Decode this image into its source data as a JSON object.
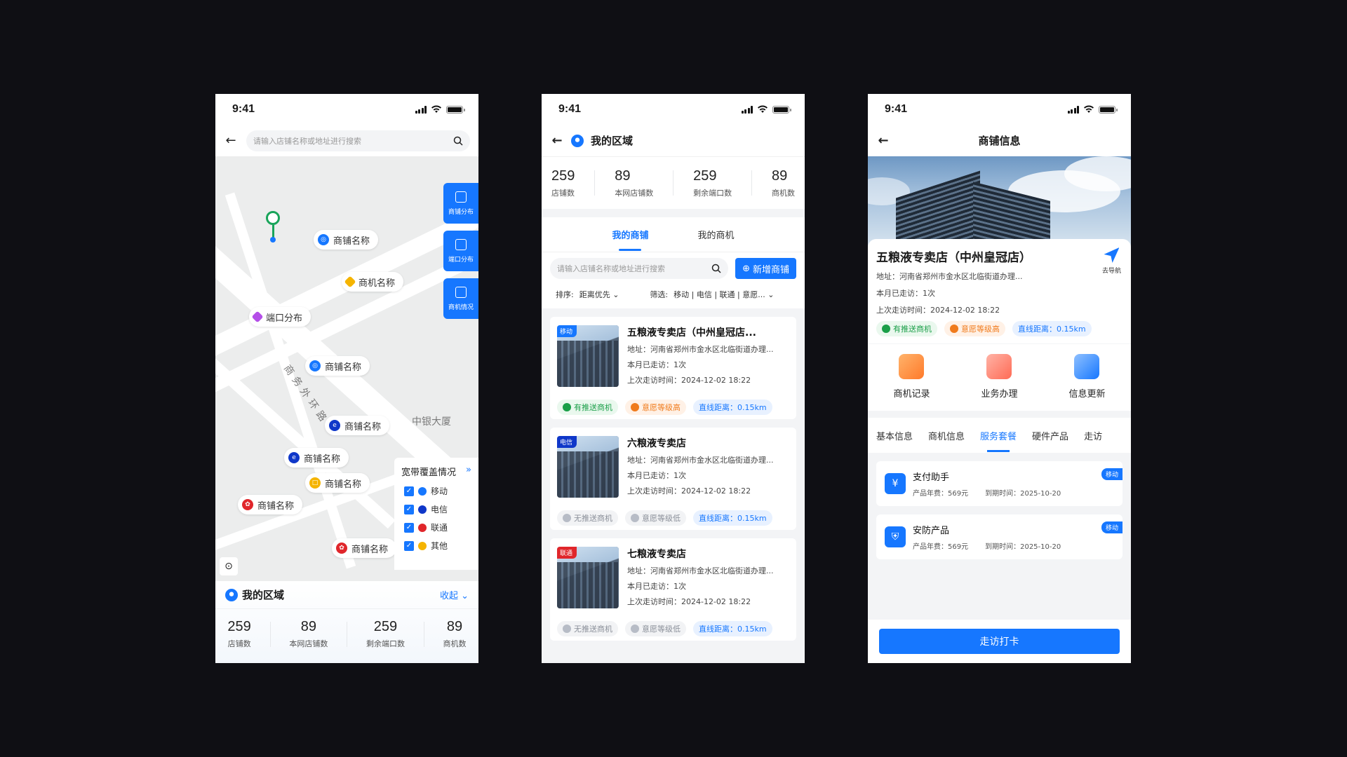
{
  "status_time": "9:41",
  "colors": {
    "accent": "#1677ff",
    "mobile": "#1677ff",
    "telecom": "#0f37c9",
    "unicom": "#e0262b",
    "other": "#f5b400"
  },
  "screen1": {
    "search_placeholder": "请输入店铺名称或地址进行搜索",
    "side_buttons": [
      "商铺分布",
      "端口分布",
      "商机情况"
    ],
    "pins": [
      "商铺名称",
      "商机名称",
      "端口分布",
      "商铺名称",
      "商铺名称",
      "商铺名称",
      "商铺名称",
      "商铺名称",
      "商铺名称"
    ],
    "road_label": "商务外环路",
    "building_label": "中银大厦",
    "legend": {
      "title": "宽带覆盖情况",
      "items": [
        "移动",
        "电信",
        "联通",
        "其他"
      ]
    },
    "region_title": "我的区域",
    "collapse": "收起",
    "stats": [
      {
        "value": "259",
        "label": "店铺数"
      },
      {
        "value": "89",
        "label": "本网店铺数"
      },
      {
        "value": "259",
        "label": "剩余端口数"
      },
      {
        "value": "89",
        "label": "商机数"
      }
    ]
  },
  "screen2": {
    "title": "我的区域",
    "stats": [
      {
        "value": "259",
        "label": "店铺数"
      },
      {
        "value": "89",
        "label": "本网店铺数"
      },
      {
        "value": "259",
        "label": "剩余端口数"
      },
      {
        "value": "89",
        "label": "商机数"
      }
    ],
    "tabs": [
      "我的商铺",
      "我的商机"
    ],
    "search_placeholder": "请输入店铺名称或地址进行搜索",
    "add_button": "新增商铺",
    "sort_label": "排序:",
    "sort_value": "距离优先",
    "filter_label": "筛选:",
    "filter_options": "移动 | 电信 | 联通 | 意愿...",
    "cards": [
      {
        "tag": "移动",
        "name": "五粮液专卖店（中州皇冠店...",
        "address": "地址：河南省郑州市金水区北临街道办理...",
        "visits": "本月已走访：1次",
        "last": "上次走访时间：2024-12-02 18:22",
        "chip1": "有推送商机",
        "chip2": "意愿等级高",
        "distance": "直线距离：0.15km"
      },
      {
        "tag": "电信",
        "name": "六粮液专卖店",
        "address": "地址：河南省郑州市金水区北临街道办理...",
        "visits": "本月已走访：1次",
        "last": "上次走访时间：2024-12-02 18:22",
        "chip1": "无推送商机",
        "chip2": "意愿等级低",
        "distance": "直线距离：0.15km"
      },
      {
        "tag": "联通",
        "name": "七粮液专卖店",
        "address": "地址：河南省郑州市金水区北临街道办理...",
        "visits": "本月已走访：1次",
        "last": "上次走访时间：2024-12-02 18:22",
        "chip1": "无推送商机",
        "chip2": "意愿等级低",
        "distance": "直线距离：0.15km"
      }
    ]
  },
  "screen3": {
    "title": "商铺信息",
    "shop_name": "五粮液专卖店（中州皇冠店）",
    "nav_label": "去导航",
    "address": "地址：河南省郑州市金水区北临街道办理...",
    "visits": "本月已走访：1次",
    "last": "上次走访时间：2024-12-02 18:22",
    "chip1": "有推送商机",
    "chip2": "意愿等级高",
    "distance": "直线距离：0.15km",
    "actions": [
      "商机记录",
      "业务办理",
      "信息更新"
    ],
    "tabs": [
      "基本信息",
      "商机信息",
      "服务套餐",
      "硬件产品",
      "走访"
    ],
    "services": [
      {
        "name": "支付助手",
        "fee": "产品年费：569元",
        "expire": "到期时间：2025-10-20",
        "badge": "移动"
      },
      {
        "name": "安防产品",
        "fee": "产品年费：569元",
        "expire": "到期时间：2025-10-20",
        "badge": "移动"
      }
    ],
    "checkin_button": "走访打卡"
  }
}
